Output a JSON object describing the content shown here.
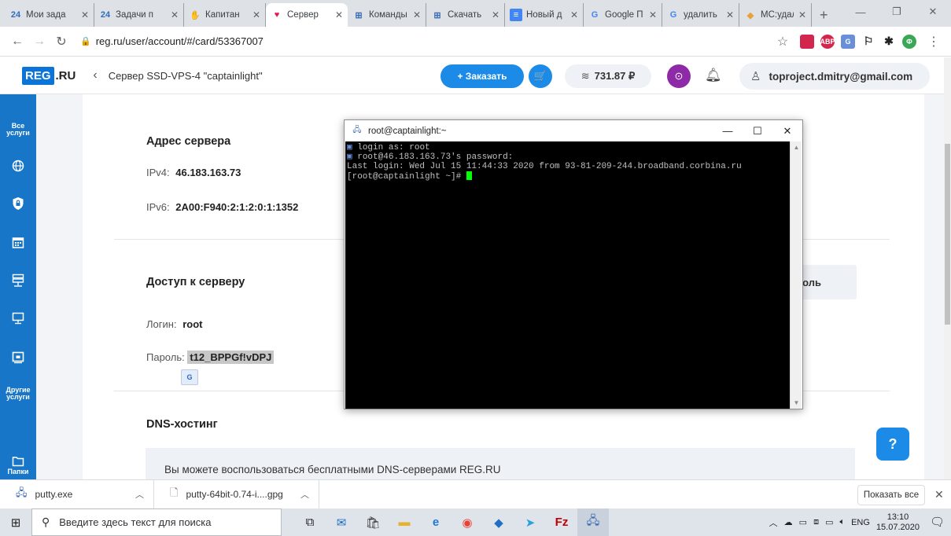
{
  "browser": {
    "tabs": [
      {
        "favicon": "24",
        "title": "Мои зада",
        "active": false
      },
      {
        "favicon": "24",
        "title": "Задачи п",
        "active": false
      },
      {
        "favicon": "✋",
        "title": "Капитан",
        "active": false
      },
      {
        "favicon": "♥",
        "title": "Сервер",
        "active": true
      },
      {
        "favicon": "⊞",
        "title": "Команды",
        "active": false
      },
      {
        "favicon": "⊞",
        "title": "Скачать",
        "active": false
      },
      {
        "favicon": "≡",
        "title": "Новый д",
        "active": false
      },
      {
        "favicon": "G",
        "title": "Google П",
        "active": false
      },
      {
        "favicon": "G",
        "title": "удалить",
        "active": false
      },
      {
        "favicon": "◆",
        "title": "MC:удал",
        "active": false
      }
    ],
    "url": "reg.ru/user/account/#/card/53367007"
  },
  "header": {
    "logo_reg": "REG",
    "logo_ru": ".RU",
    "breadcrumb": "Сервер SSD-VPS-4 \"captainlight\"",
    "order_label": "+ Заказать",
    "balance": "731.87 ₽",
    "account_email": "toproject.dmitry@gmail.com"
  },
  "sidebar": {
    "all_services": "Все\nуслуги",
    "other_services": "Другие\nуслуги",
    "folders": "Папки"
  },
  "content": {
    "server_address_title": "Адрес сервера",
    "ipv4_label": "IPv4:",
    "ipv4_value": "46.183.163.73",
    "ipv6_label": "IPv6:",
    "ipv6_value": "2A00:F940:2:1:2:0:1:1352",
    "access_title": "Доступ к серверу",
    "login_label": "Логин:",
    "login_value": "root",
    "password_label": "Пароль:",
    "password_value": "t12_BPPGf!vDPJ",
    "password_button_partial": "ароль",
    "dns_title": "DNS-хостинг",
    "dns_text": "Вы можете воспользоваться бесплатными DNS-серверами REG.RU",
    "help_label": "?"
  },
  "putty": {
    "title": "root@captainlight:~",
    "lines": [
      "login as: root",
      "root@46.183.163.73's password:",
      "Last login: Wed Jul 15 11:44:33 2020 from 93-81-209-244.broadband.corbina.ru",
      "[root@captainlight ~]# "
    ]
  },
  "downloads": {
    "items": [
      {
        "name": "putty.exe"
      },
      {
        "name": "putty-64bit-0.74-i....gpg"
      }
    ],
    "show_all": "Показать все"
  },
  "taskbar": {
    "search_placeholder": "Введите здесь текст для поиска",
    "lang": "ENG",
    "time": "13:10",
    "date": "15.07.2020"
  },
  "colors": {
    "brand_blue": "#1c8be8",
    "sidebar_blue": "#1876c9",
    "terminal_cursor": "#00ff00"
  }
}
